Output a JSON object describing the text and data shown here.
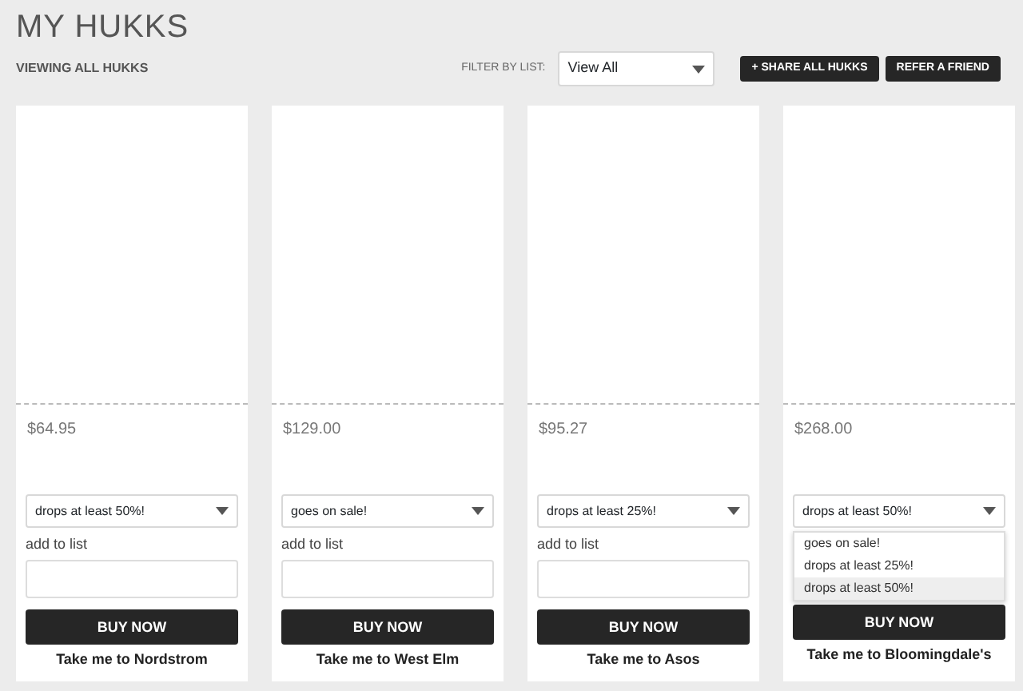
{
  "page_title": "MY HUKKS",
  "subtitle": "VIEWING ALL HUKKS",
  "filter": {
    "label": "FILTER BY LIST:",
    "value": "View All"
  },
  "actions": [
    "+ SHARE ALL HUKKS",
    "REFER A FRIEND"
  ],
  "products": [
    {
      "price": "$64.95",
      "alert": "drops at least 50%!",
      "list_label": "add to list",
      "buy": "BUY NOW",
      "store_link": "Take me to Nordstrom"
    },
    {
      "price": "$129.00",
      "alert": "goes on sale!",
      "list_label": "add to list",
      "buy": "BUY NOW",
      "store_link": "Take me to West Elm"
    },
    {
      "price": "$95.27",
      "alert": "drops at least 25%!",
      "list_label": "add to list",
      "buy": "BUY NOW",
      "store_link": "Take me to Asos"
    },
    {
      "price": "$268.00",
      "alert": "drops at least 50%!",
      "buy": "BUY NOW",
      "store_link": "Take me to Bloomingdale's",
      "alert_menu": [
        {
          "label": "goes on sale!",
          "selected": false
        },
        {
          "label": "drops at least 25%!",
          "selected": false
        },
        {
          "label": "drops at least 50%!",
          "selected": true
        }
      ]
    }
  ]
}
